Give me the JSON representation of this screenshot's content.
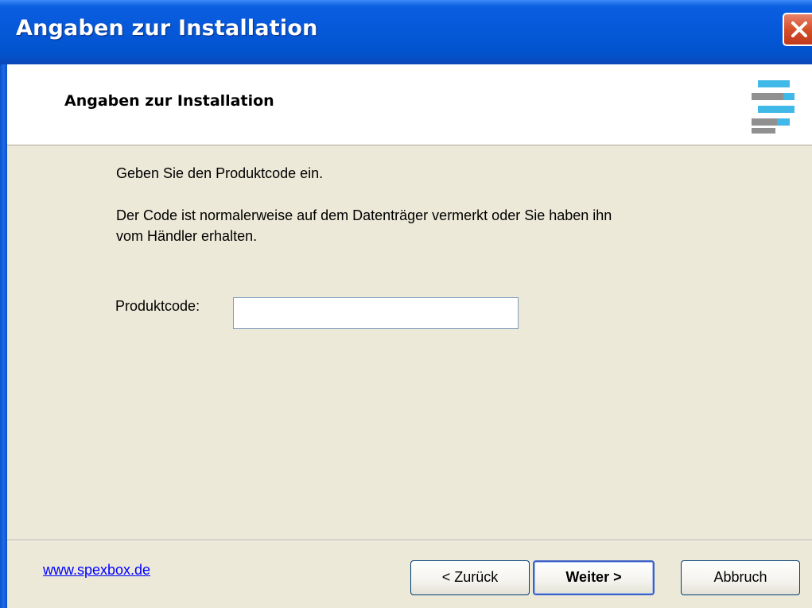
{
  "window": {
    "title": "Angaben zur Installation"
  },
  "header": {
    "title": "Angaben zur Installation",
    "logo_icon": "setup-logo-icon"
  },
  "body": {
    "line1": "Geben Sie den Produktcode ein.",
    "line2a": "Der Code ist normalerweise auf dem Datenträger vermerkt oder Sie haben ihn",
    "line2b": "vom Händler erhalten."
  },
  "form": {
    "product_code_label": "Produktcode:",
    "product_code_value": "",
    "product_code_placeholder": ""
  },
  "footer": {
    "link": "www.spexbox.de",
    "back_label": "< Zurück",
    "next_label": "Weiter >",
    "cancel_label": "Abbruch"
  },
  "colors": {
    "titlebar": "#0558d8",
    "background": "#ece9d8",
    "link": "#0000ff",
    "close": "#d4502a"
  }
}
